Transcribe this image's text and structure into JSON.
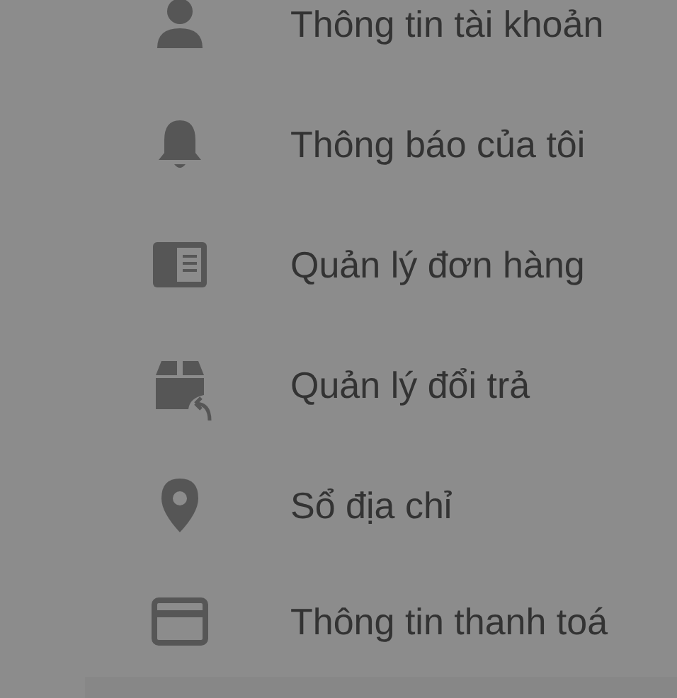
{
  "menu": {
    "items": [
      {
        "kind": "account",
        "label": "Thông tin tài khoản"
      },
      {
        "kind": "notifications",
        "label": "Thông báo của tôi"
      },
      {
        "kind": "orders",
        "label": "Quản lý đơn hàng"
      },
      {
        "kind": "returns",
        "label": "Quản lý đổi trả"
      },
      {
        "kind": "addresses",
        "label": "Sổ địa chỉ"
      },
      {
        "kind": "payment",
        "label": "Thông tin thanh toá"
      }
    ]
  }
}
